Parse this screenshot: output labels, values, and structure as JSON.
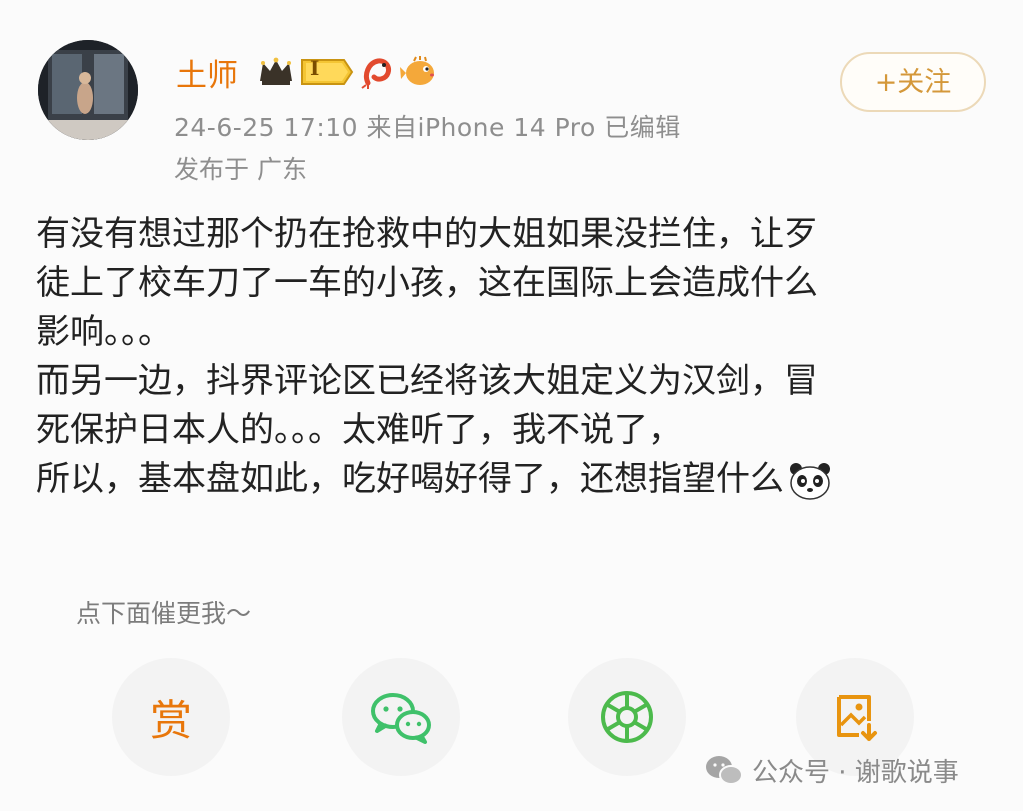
{
  "user": {
    "name": "土师",
    "level_badge": "I"
  },
  "post": {
    "meta": "24-6-25 17:10  来自iPhone 14 Pro  已编辑",
    "location": "发布于 广东",
    "lines": [
      "有没有想过那个扔在抢救中的大姐如果没拦住，让歹",
      "徒上了校车刀了一车的小孩，这在国际上会造成什么",
      "影响。。。",
      "而另一边，抖界评论区已经将该大姐定义为汉剑，冒",
      "死保护日本人的。。。太难听了，我不说了，",
      "所以，基本盘如此，吃好喝好得了，还想指望什么"
    ]
  },
  "follow_label": "+关注",
  "hint": "点下面催更我～",
  "actions": {
    "reward_label": "赏"
  },
  "watermark": "公众号 · 谢歌说事",
  "icons": {
    "crown": "crown-icon",
    "shrimp": "shrimp-icon",
    "pufferfish": "pufferfish-icon",
    "panda": "panda-emoji-icon",
    "wechat": "wechat-icon",
    "moments": "moments-icon",
    "image": "image-download-icon"
  },
  "colors": {
    "accent": "#e8760a",
    "follow_border": "#ecd9b8",
    "wechat_green": "#3fc16a"
  }
}
